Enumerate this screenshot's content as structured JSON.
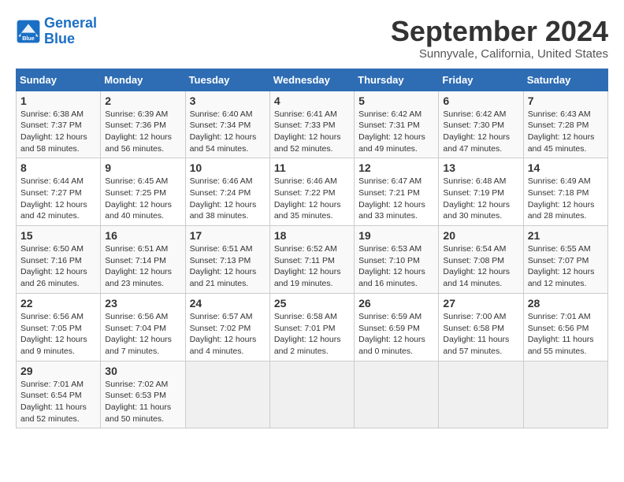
{
  "header": {
    "logo_line1": "General",
    "logo_line2": "Blue",
    "month_title": "September 2024",
    "location": "Sunnyvale, California, United States"
  },
  "weekdays": [
    "Sunday",
    "Monday",
    "Tuesday",
    "Wednesday",
    "Thursday",
    "Friday",
    "Saturday"
  ],
  "weeks": [
    [
      {
        "day": "1",
        "sunrise": "6:38 AM",
        "sunset": "7:37 PM",
        "daylight": "12 hours and 58 minutes."
      },
      {
        "day": "2",
        "sunrise": "6:39 AM",
        "sunset": "7:36 PM",
        "daylight": "12 hours and 56 minutes."
      },
      {
        "day": "3",
        "sunrise": "6:40 AM",
        "sunset": "7:34 PM",
        "daylight": "12 hours and 54 minutes."
      },
      {
        "day": "4",
        "sunrise": "6:41 AM",
        "sunset": "7:33 PM",
        "daylight": "12 hours and 52 minutes."
      },
      {
        "day": "5",
        "sunrise": "6:42 AM",
        "sunset": "7:31 PM",
        "daylight": "12 hours and 49 minutes."
      },
      {
        "day": "6",
        "sunrise": "6:42 AM",
        "sunset": "7:30 PM",
        "daylight": "12 hours and 47 minutes."
      },
      {
        "day": "7",
        "sunrise": "6:43 AM",
        "sunset": "7:28 PM",
        "daylight": "12 hours and 45 minutes."
      }
    ],
    [
      {
        "day": "8",
        "sunrise": "6:44 AM",
        "sunset": "7:27 PM",
        "daylight": "12 hours and 42 minutes."
      },
      {
        "day": "9",
        "sunrise": "6:45 AM",
        "sunset": "7:25 PM",
        "daylight": "12 hours and 40 minutes."
      },
      {
        "day": "10",
        "sunrise": "6:46 AM",
        "sunset": "7:24 PM",
        "daylight": "12 hours and 38 minutes."
      },
      {
        "day": "11",
        "sunrise": "6:46 AM",
        "sunset": "7:22 PM",
        "daylight": "12 hours and 35 minutes."
      },
      {
        "day": "12",
        "sunrise": "6:47 AM",
        "sunset": "7:21 PM",
        "daylight": "12 hours and 33 minutes."
      },
      {
        "day": "13",
        "sunrise": "6:48 AM",
        "sunset": "7:19 PM",
        "daylight": "12 hours and 30 minutes."
      },
      {
        "day": "14",
        "sunrise": "6:49 AM",
        "sunset": "7:18 PM",
        "daylight": "12 hours and 28 minutes."
      }
    ],
    [
      {
        "day": "15",
        "sunrise": "6:50 AM",
        "sunset": "7:16 PM",
        "daylight": "12 hours and 26 minutes."
      },
      {
        "day": "16",
        "sunrise": "6:51 AM",
        "sunset": "7:14 PM",
        "daylight": "12 hours and 23 minutes."
      },
      {
        "day": "17",
        "sunrise": "6:51 AM",
        "sunset": "7:13 PM",
        "daylight": "12 hours and 21 minutes."
      },
      {
        "day": "18",
        "sunrise": "6:52 AM",
        "sunset": "7:11 PM",
        "daylight": "12 hours and 19 minutes."
      },
      {
        "day": "19",
        "sunrise": "6:53 AM",
        "sunset": "7:10 PM",
        "daylight": "12 hours and 16 minutes."
      },
      {
        "day": "20",
        "sunrise": "6:54 AM",
        "sunset": "7:08 PM",
        "daylight": "12 hours and 14 minutes."
      },
      {
        "day": "21",
        "sunrise": "6:55 AM",
        "sunset": "7:07 PM",
        "daylight": "12 hours and 12 minutes."
      }
    ],
    [
      {
        "day": "22",
        "sunrise": "6:56 AM",
        "sunset": "7:05 PM",
        "daylight": "12 hours and 9 minutes."
      },
      {
        "day": "23",
        "sunrise": "6:56 AM",
        "sunset": "7:04 PM",
        "daylight": "12 hours and 7 minutes."
      },
      {
        "day": "24",
        "sunrise": "6:57 AM",
        "sunset": "7:02 PM",
        "daylight": "12 hours and 4 minutes."
      },
      {
        "day": "25",
        "sunrise": "6:58 AM",
        "sunset": "7:01 PM",
        "daylight": "12 hours and 2 minutes."
      },
      {
        "day": "26",
        "sunrise": "6:59 AM",
        "sunset": "6:59 PM",
        "daylight": "12 hours and 0 minutes."
      },
      {
        "day": "27",
        "sunrise": "7:00 AM",
        "sunset": "6:58 PM",
        "daylight": "11 hours and 57 minutes."
      },
      {
        "day": "28",
        "sunrise": "7:01 AM",
        "sunset": "6:56 PM",
        "daylight": "11 hours and 55 minutes."
      }
    ],
    [
      {
        "day": "29",
        "sunrise": "7:01 AM",
        "sunset": "6:54 PM",
        "daylight": "11 hours and 52 minutes."
      },
      {
        "day": "30",
        "sunrise": "7:02 AM",
        "sunset": "6:53 PM",
        "daylight": "11 hours and 50 minutes."
      },
      null,
      null,
      null,
      null,
      null
    ]
  ]
}
